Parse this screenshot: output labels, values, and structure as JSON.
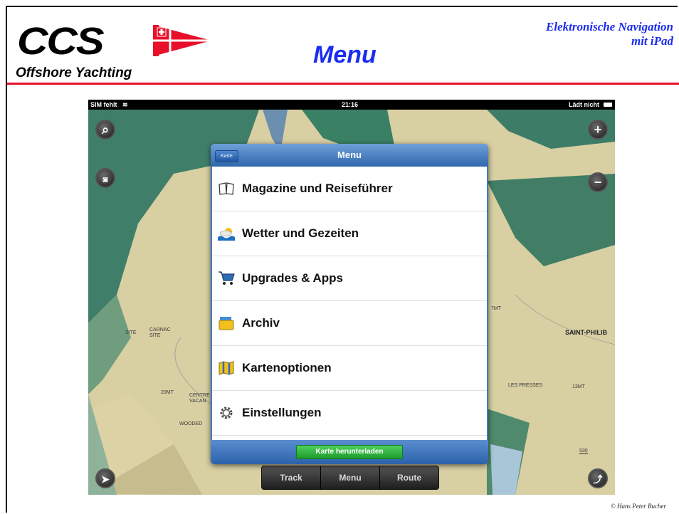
{
  "header": {
    "logo_text": "CCS",
    "logo_subtitle": "Offshore Yachting",
    "title": "Menu",
    "subtitle_line1": "Elektronische Navigation",
    "subtitle_line2": "mit  iPad",
    "credit": "© Hans Peter Bucher",
    "accent_color": "#1b2cf0",
    "rule_color": "#e8102a"
  },
  "statusbar": {
    "carrier": "SIM fehlt",
    "time": "21:16",
    "battery": "Lädt nicht"
  },
  "map": {
    "labels": [
      "SITE",
      "CARNAC",
      "SITE",
      "20MT",
      "CENTRE",
      "VACAN",
      "WOODED",
      "7MT",
      "LES PRESSES",
      "13MT",
      "SAINT-PHILIB",
      "530"
    ],
    "buttons": [
      "search-icon",
      "camera-icon",
      "zoom-in-icon",
      "zoom-out-icon",
      "locate-icon",
      "route-icon"
    ]
  },
  "popover": {
    "title": "Menu",
    "back_label": "Karte",
    "items": [
      {
        "label": "Magazine und Reiseführer",
        "icon": "book-icon"
      },
      {
        "label": "Wetter und Gezeiten",
        "icon": "weather-icon"
      },
      {
        "label": "Upgrades & Apps",
        "icon": "cart-icon"
      },
      {
        "label": "Archiv",
        "icon": "folder-icon"
      },
      {
        "label": "Kartenoptionen",
        "icon": "map-icon"
      },
      {
        "label": "Einstellungen",
        "icon": "gear-icon"
      }
    ],
    "download_label": "Karte herunterladen"
  },
  "toolbar": {
    "tabs": [
      "Track",
      "Menu",
      "Route"
    ]
  }
}
